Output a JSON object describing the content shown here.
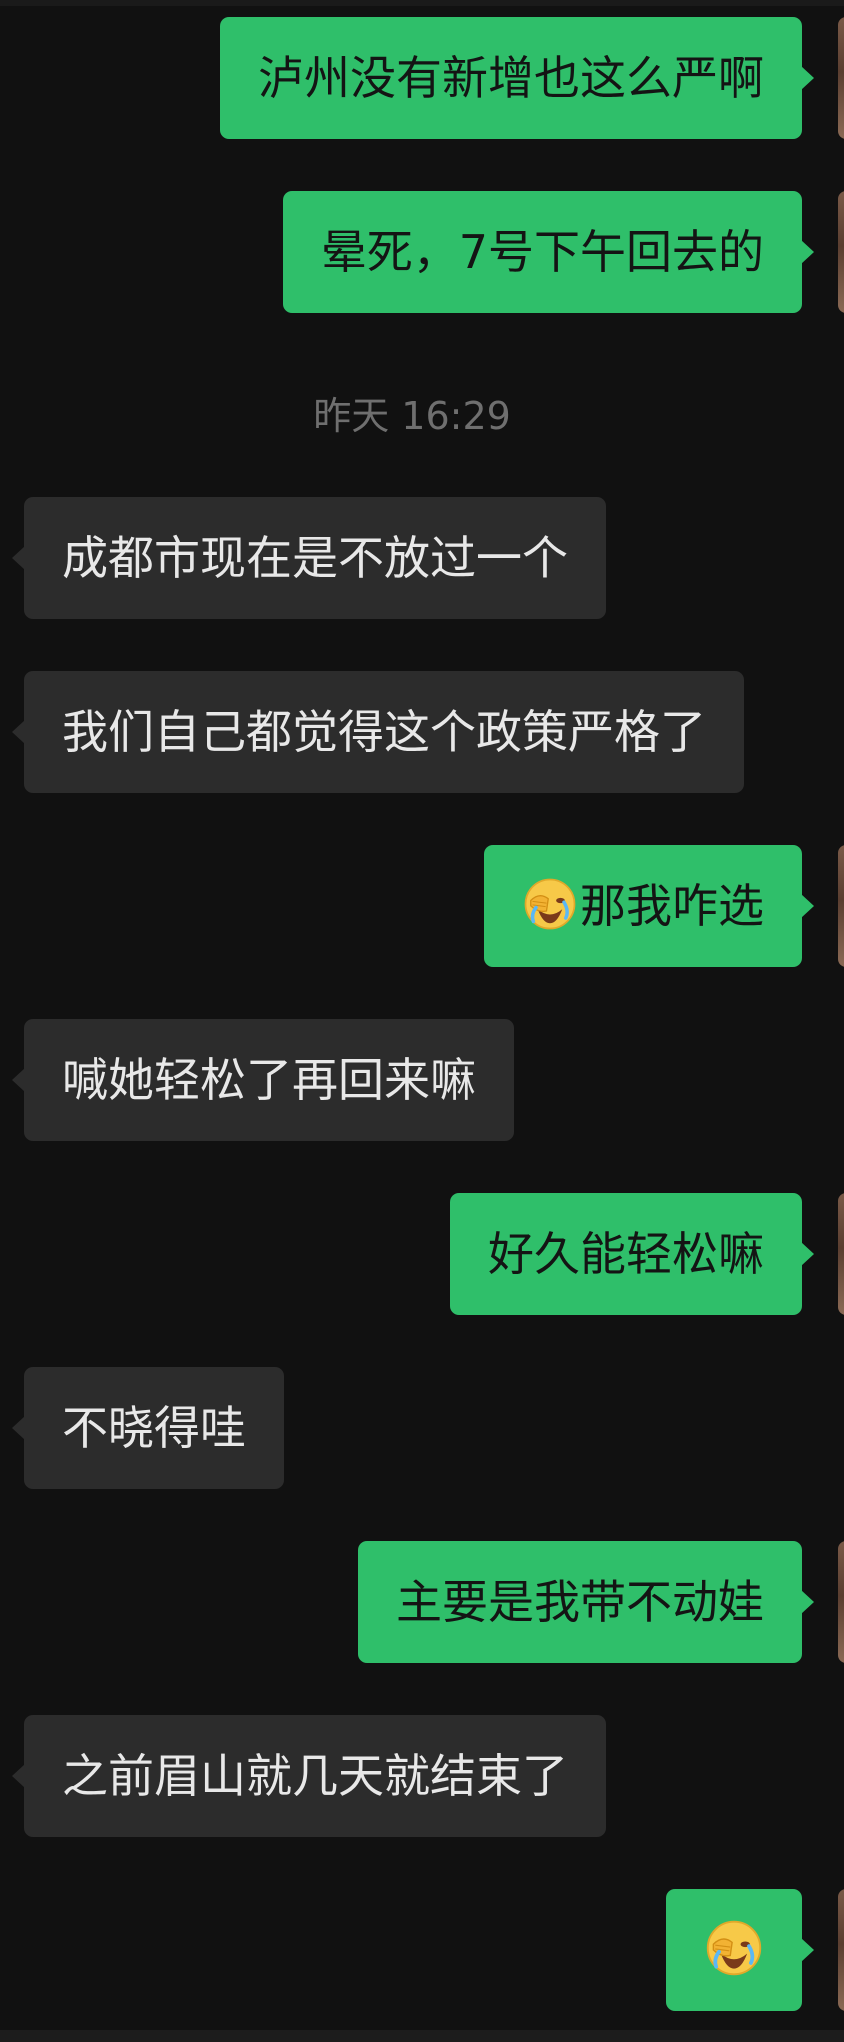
{
  "chat": {
    "timestamp": "昨天 16:29",
    "messages": [
      {
        "side": "out",
        "text": "泸州没有新增也这么严啊"
      },
      {
        "side": "out",
        "text": "晕死，7号下午回去的"
      },
      {
        "side": "in",
        "text": "成都市现在是不放过一个"
      },
      {
        "side": "in",
        "text": "我们自己都觉得这个政策严格了"
      },
      {
        "side": "out",
        "text": "那我咋选",
        "emoji": "face-palm-crying-emoji"
      },
      {
        "side": "in",
        "text": "喊她轻松了再回来嘛"
      },
      {
        "side": "out",
        "text": "好久能轻松嘛"
      },
      {
        "side": "in",
        "text": "不晓得哇"
      },
      {
        "side": "out",
        "text": "主要是我带不动娃"
      },
      {
        "side": "in",
        "text": "之前眉山就几天就结束了"
      },
      {
        "side": "out",
        "text": "",
        "emoji": "face-palm-crying-emoji"
      }
    ]
  },
  "colors": {
    "background": "#111111",
    "outgoing_bubble": "#2fbf6a",
    "incoming_bubble": "#2c2c2c",
    "timestamp_text": "#6f6f6f"
  }
}
